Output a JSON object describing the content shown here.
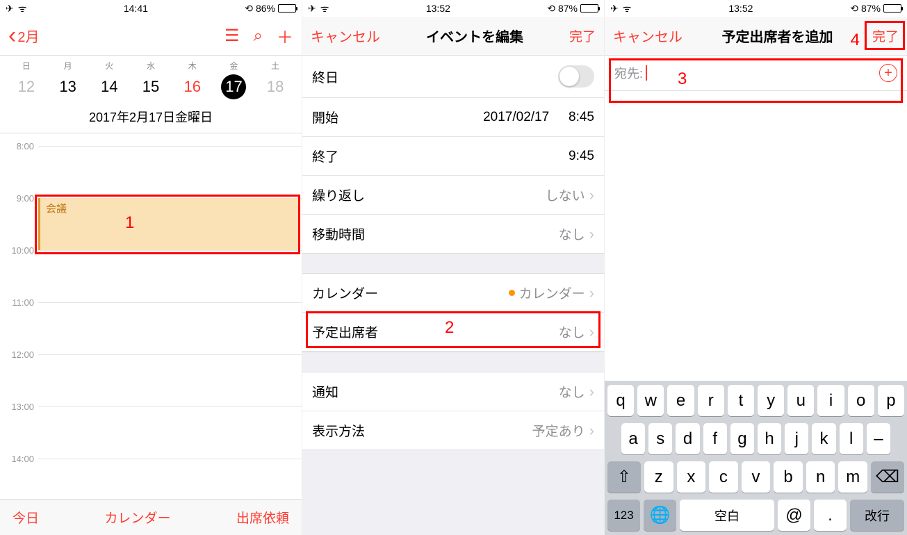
{
  "phone1": {
    "status": {
      "time": "14:41",
      "battery": "86%"
    },
    "nav": {
      "back": "2月"
    },
    "weekdays": [
      "日",
      "月",
      "火",
      "水",
      "木",
      "金",
      "土"
    ],
    "days": [
      {
        "n": "12",
        "cls": "gray"
      },
      {
        "n": "13"
      },
      {
        "n": "14"
      },
      {
        "n": "15"
      },
      {
        "n": "16",
        "cls": "red"
      },
      {
        "n": "17",
        "cls": "selected"
      },
      {
        "n": "18",
        "cls": "gray"
      }
    ],
    "fullDate": "2017年2月17日金曜日",
    "hours": [
      "8:00",
      "9:00",
      "10:00",
      "11:00",
      "12:00",
      "13:00",
      "14:00"
    ],
    "event": "会議",
    "toolbar": {
      "today": "今日",
      "calendars": "カレンダー",
      "inbox": "出席依頼"
    },
    "annotation": "1"
  },
  "phone2": {
    "status": {
      "time": "13:52",
      "battery": "87%"
    },
    "nav": {
      "cancel": "キャンセル",
      "title": "イベントを編集",
      "done": "完了"
    },
    "rows": {
      "allday": {
        "label": "終日"
      },
      "start": {
        "label": "開始",
        "date": "2017/02/17",
        "time": "8:45"
      },
      "end": {
        "label": "終了",
        "time": "9:45"
      },
      "repeat": {
        "label": "繰り返し",
        "value": "しない"
      },
      "travel": {
        "label": "移動時間",
        "value": "なし"
      },
      "calendar": {
        "label": "カレンダー",
        "value": "カレンダー"
      },
      "invitees": {
        "label": "予定出席者",
        "value": "なし"
      },
      "alert": {
        "label": "通知",
        "value": "なし"
      },
      "show": {
        "label": "表示方法",
        "value": "予定あり"
      }
    },
    "annotation": "2"
  },
  "phone3": {
    "status": {
      "time": "13:52",
      "battery": "87%"
    },
    "nav": {
      "cancel": "キャンセル",
      "title": "予定出席者を追加",
      "done": "完了"
    },
    "recipient": {
      "label": "宛先:"
    },
    "keyboard": {
      "row1": [
        "q",
        "w",
        "e",
        "r",
        "t",
        "y",
        "u",
        "i",
        "o",
        "p"
      ],
      "row2": [
        "a",
        "s",
        "d",
        "f",
        "g",
        "h",
        "j",
        "k",
        "l",
        "–"
      ],
      "row3": [
        "z",
        "x",
        "c",
        "v",
        "b",
        "n",
        "m"
      ],
      "num": "123",
      "space": "空白",
      "at": "@",
      "dot": ".",
      "ret": "改行"
    },
    "annotation3": "3",
    "annotation4": "4"
  }
}
